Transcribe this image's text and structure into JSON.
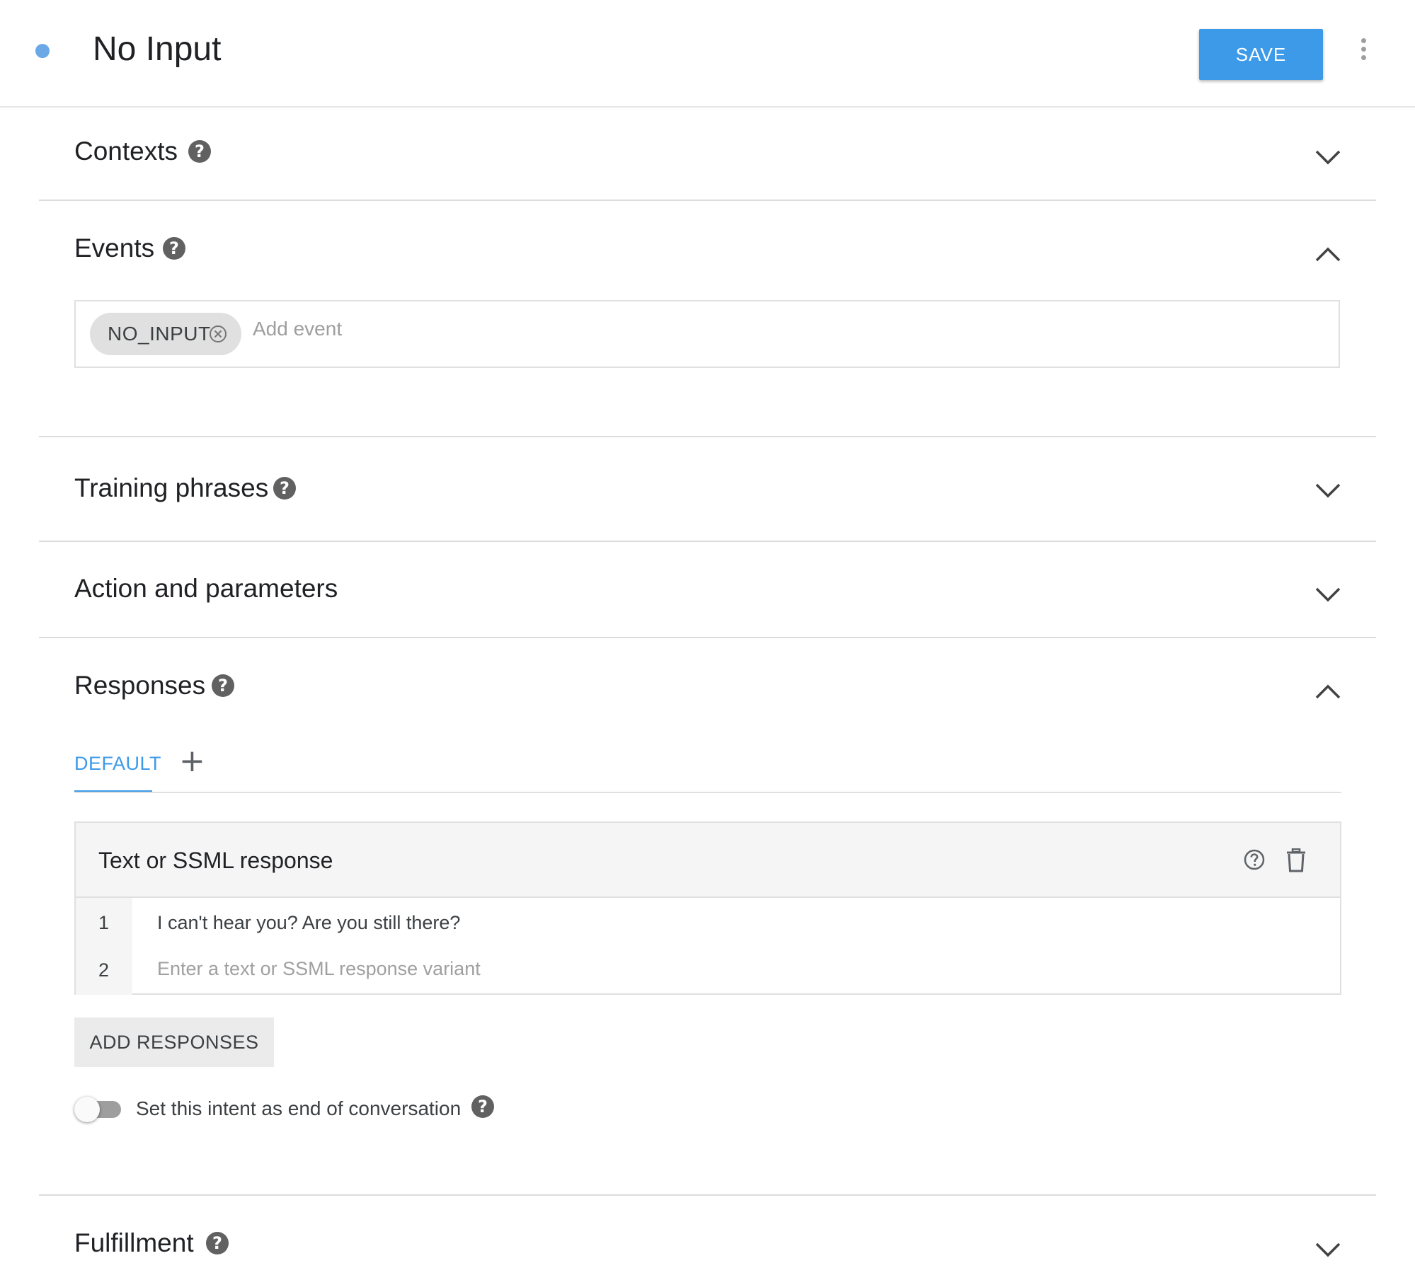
{
  "header": {
    "title": "No Input",
    "save_label": "SAVE"
  },
  "sections": {
    "contexts": {
      "title": "Contexts",
      "expanded": false
    },
    "events": {
      "title": "Events",
      "expanded": true,
      "chips": [
        "NO_INPUT"
      ],
      "placeholder": "Add event"
    },
    "training_phrases": {
      "title": "Training phrases",
      "expanded": false
    },
    "action_parameters": {
      "title": "Action and parameters",
      "expanded": false
    },
    "responses": {
      "title": "Responses",
      "expanded": true,
      "tabs": [
        "DEFAULT"
      ],
      "add_tab_label": "+",
      "card": {
        "title": "Text or SSML response",
        "rows": [
          {
            "num": "1",
            "text": "I can't hear you? Are you still there?"
          },
          {
            "num": "2",
            "placeholder": "Enter a text or SSML response variant"
          }
        ]
      },
      "add_button": "ADD RESPONSES",
      "end_conversation": {
        "label": "Set this intent as end of conversation",
        "enabled": false
      }
    },
    "fulfillment": {
      "title": "Fulfillment",
      "expanded": false
    }
  },
  "colors": {
    "accent": "#3d9ae8",
    "status_dot": "#6aa9e6"
  }
}
